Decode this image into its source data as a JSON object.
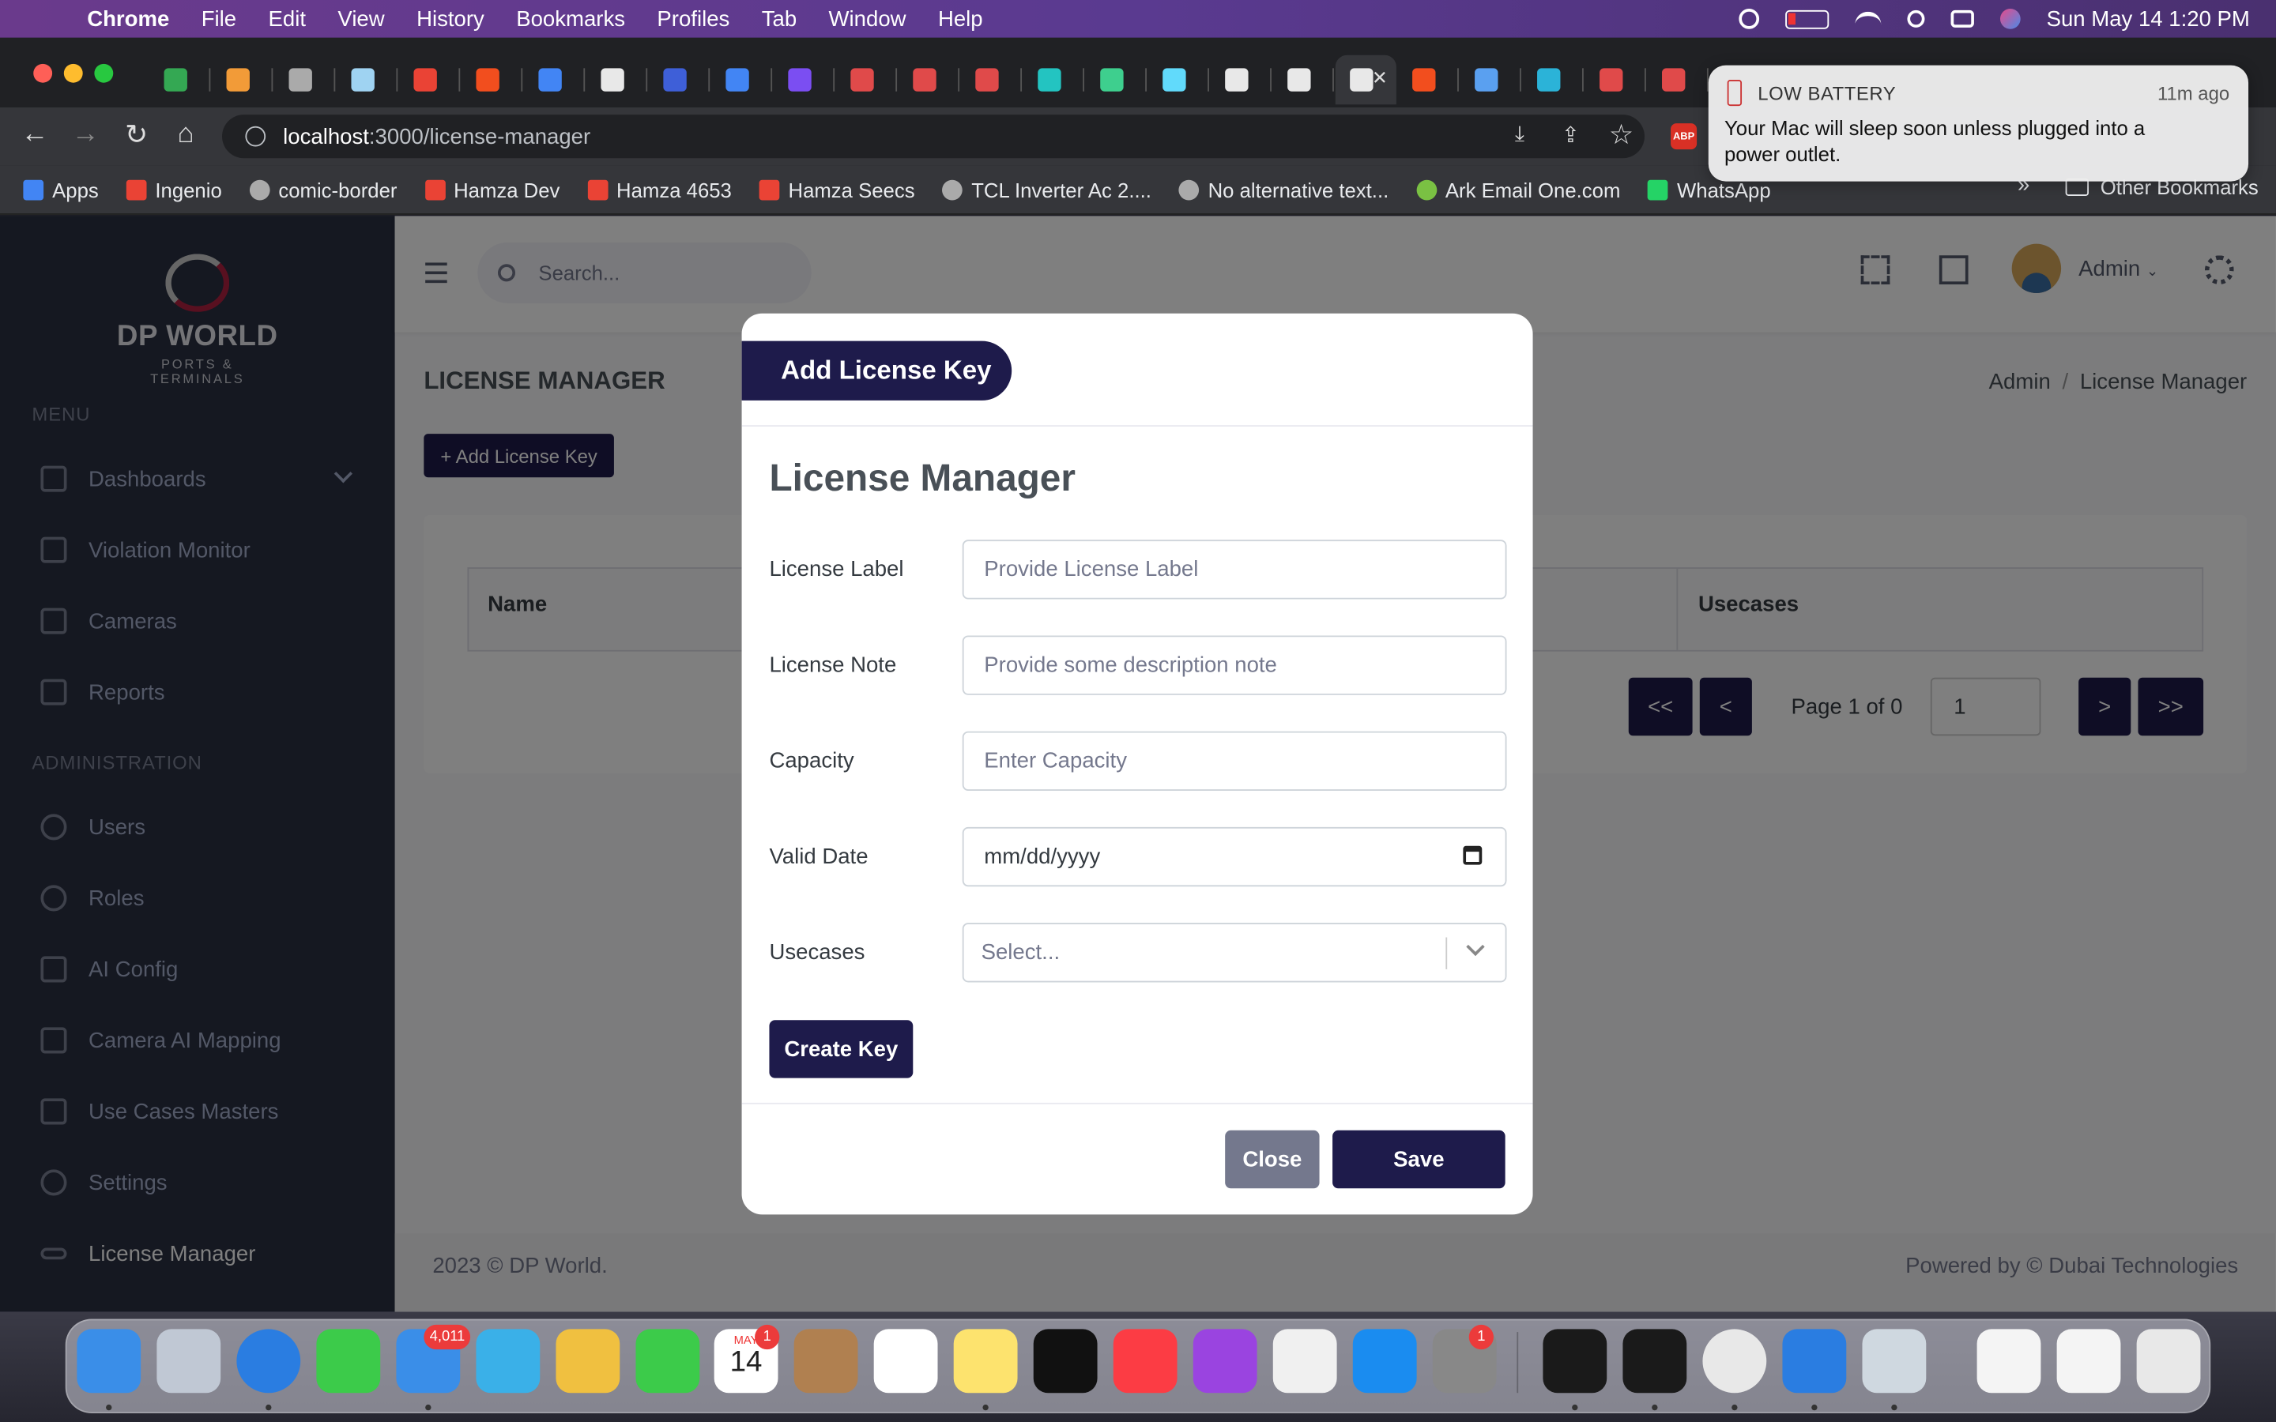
{
  "menubar": {
    "app_name": "Chrome",
    "items": [
      "File",
      "Edit",
      "View",
      "History",
      "Bookmarks",
      "Profiles",
      "Tab",
      "Window",
      "Help"
    ],
    "datetime": "Sun May 14  1:20 PM"
  },
  "browser": {
    "url_host": "localhost",
    "url_path": ":3000/license-manager",
    "tab_colors": [
      "#34a853",
      "#f29b38",
      "#aaaaaa",
      "#9fd3f2",
      "#ea4335",
      "#f24e1e",
      "#4285f4",
      "#e8e8e8",
      "#3e5fd8",
      "#4285f4",
      "#7b4ef2",
      "#e04a4a",
      "#e04a4a",
      "#e04a4a",
      "#23c4c1",
      "#3ecf8e",
      "#61dafb",
      "#e8e8e8",
      "#e8e8e8",
      "#e8e8e8",
      "#f24e1e",
      "#5aa0f0",
      "#2bb3d8",
      "#e04a4a",
      "#e04a4a"
    ],
    "bookmarks": [
      {
        "label": "Apps",
        "color": "#4285f4"
      },
      {
        "label": "Ingenio",
        "color": "#ea4335"
      },
      {
        "label": "comic-border",
        "color": "#aaaaaa"
      },
      {
        "label": "Hamza Dev",
        "color": "#ea4335"
      },
      {
        "label": "Hamza 4653",
        "color": "#ea4335"
      },
      {
        "label": "Hamza Seecs",
        "color": "#ea4335"
      },
      {
        "label": "TCL Inverter Ac 2....",
        "color": "#aaaaaa"
      },
      {
        "label": "No alternative text...",
        "color": "#aaaaaa"
      },
      {
        "label": "Ark Email One.com",
        "color": "#7ac143"
      },
      {
        "label": "WhatsApp",
        "color": "#25d366"
      }
    ],
    "other_bookmarks": "Other Bookmarks",
    "overflow": "»"
  },
  "notification": {
    "title": "LOW BATTERY",
    "time": "11m ago",
    "body": "Your Mac will sleep soon unless plugged into a power outlet."
  },
  "sidebar": {
    "logo_title": "DP WORLD",
    "logo_subtitle": "PORTS & TERMINALS",
    "menu_header": "MENU",
    "admin_header": "ADMINISTRATION",
    "items": [
      {
        "label": "Dashboards"
      },
      {
        "label": "Violation Monitor"
      },
      {
        "label": "Cameras"
      },
      {
        "label": "Reports"
      },
      {
        "label": "Users"
      },
      {
        "label": "Roles"
      },
      {
        "label": "AI Config"
      },
      {
        "label": "Camera AI Mapping"
      },
      {
        "label": "Use Cases Masters"
      },
      {
        "label": "Settings"
      },
      {
        "label": "License Manager"
      }
    ]
  },
  "topbar": {
    "search_placeholder": "Search...",
    "user": "Admin"
  },
  "page": {
    "title": "LICENSE MANAGER",
    "breadcrumb": [
      "Admin",
      "License Manager"
    ],
    "add_button": "+ Add License Key",
    "table": {
      "columns": [
        "Name",
        "Usecases"
      ]
    },
    "pagination": {
      "first": "<<",
      "prev": "<",
      "label": "Page 1 of 0",
      "input": "1",
      "next": ">",
      "last": ">>"
    },
    "footer_left": "2023 © DP World.",
    "footer_right": "Powered by © Dubai Technologies"
  },
  "modal": {
    "header": "Add License Key",
    "heading": "License Manager",
    "fields": [
      {
        "label": "License Label",
        "placeholder": "Provide License Label"
      },
      {
        "label": "License Note",
        "placeholder": "Provide some description note"
      },
      {
        "label": "Capacity",
        "placeholder": "Enter Capacity"
      },
      {
        "label": "Valid Date",
        "placeholder": "mm/dd/yyyy"
      },
      {
        "label": "Usecases",
        "placeholder": "Select..."
      }
    ],
    "create_button": "Create Key",
    "close_button": "Close",
    "save_button": "Save"
  },
  "dock": {
    "badges": {
      "mail": "4,011",
      "calendar": "1",
      "settings": "1"
    },
    "calendar_month": "MAY",
    "calendar_day": "14",
    "icon_colors": [
      "#3a8ee8",
      "#c0c8d4",
      "#2a7de1",
      "#3ccb4a",
      "#3a8ee8",
      "#3ab0e8",
      "#f0c040",
      "#3ccb4a",
      "#ffffff",
      "#b08050",
      "#ffffff",
      "#fde36e",
      "#111111",
      "#fc3c44",
      "#9a44e0",
      "#f0f0f0",
      "#1a8cf0",
      "#888888",
      "#1a1a1a",
      "#1a1a1a",
      "#e8e8e8",
      "#2a7de1",
      "#cfd8e0",
      "#f4f4f4",
      "#f4f4f4",
      "#e8e8e8"
    ]
  }
}
